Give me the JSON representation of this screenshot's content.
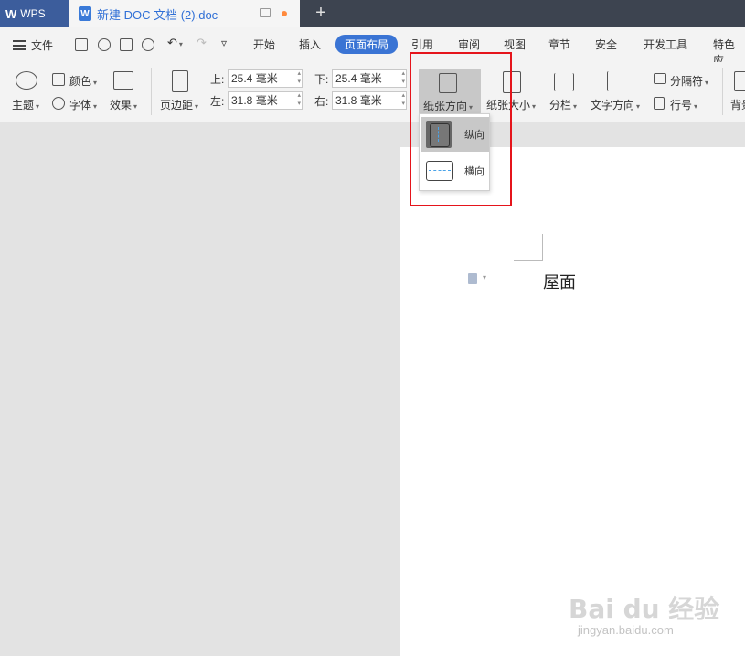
{
  "titlebar": {
    "app_tab": "WPS",
    "doc_tab": "新建 DOC 文档 (2).doc",
    "new_tab_symbol": "+"
  },
  "menubar": {
    "file_label": "文件",
    "tabs": [
      "开始",
      "插入",
      "页面布局",
      "引用",
      "审阅",
      "视图",
      "章节",
      "安全",
      "开发工具",
      "特色应"
    ],
    "active_tab": "页面布局"
  },
  "ribbon": {
    "theme_label": "主题",
    "color_label": "颜色",
    "font_label": "字体",
    "effect_label": "效果",
    "margin_label": "页边距",
    "top_label": "上:",
    "top_value": "25.4 毫米",
    "bottom_label": "下:",
    "bottom_value": "25.4 毫米",
    "left_label": "左:",
    "left_value": "31.8 毫米",
    "right_label": "右:",
    "right_value": "31.8 毫米",
    "orientation_label": "纸张方向",
    "size_label": "纸张大小",
    "columns_label": "分栏",
    "text_direction_label": "文字方向",
    "separator_label": "分隔符",
    "line_number_label": "行号",
    "background_label": "背景"
  },
  "orientation_menu": {
    "portrait": "纵向",
    "landscape": "横向",
    "selected": "纵向"
  },
  "document": {
    "text": "屋面"
  },
  "watermark": {
    "main": "Bai du 经验",
    "sub": "jingyan.baidu.com"
  },
  "colors": {
    "titlebar": "#3d4450",
    "wps_tab": "#3c5d9c",
    "active_tab": "#3a74d4",
    "highlight_box": "#e5141b"
  }
}
